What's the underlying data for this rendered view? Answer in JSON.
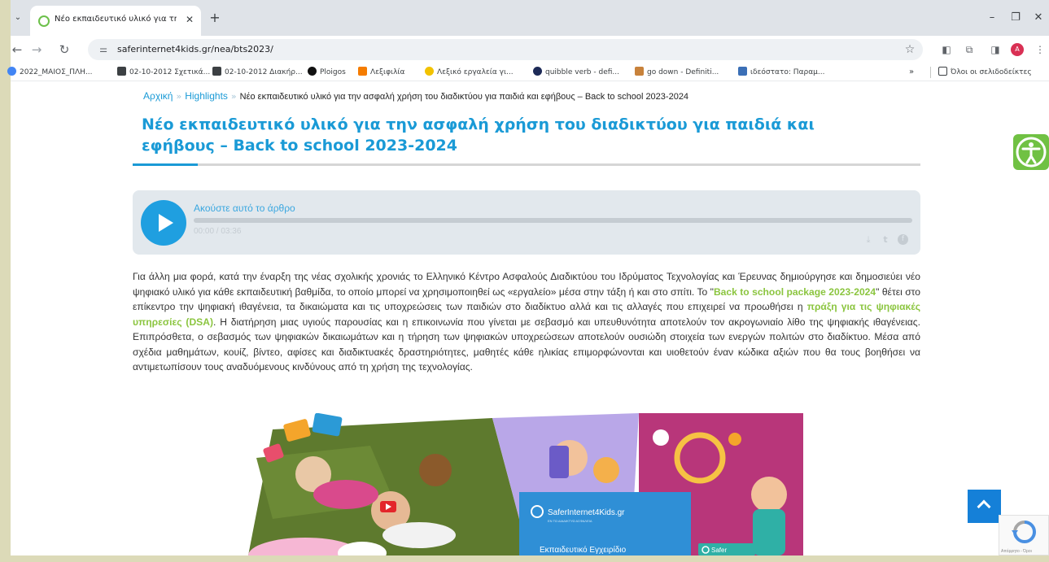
{
  "browser": {
    "tab": {
      "title": "Νέο εκπαιδευτικό υλικό για τη",
      "close": "✕"
    },
    "new_tab": "+",
    "window_controls": {
      "minimize": "–",
      "maximize": "❐",
      "close": "✕"
    },
    "url": "saferinternet4kids.gr/nea/bts2023/",
    "profile_initial": "A",
    "bookmarks": [
      {
        "label": "2022_ΜΑΙΟΣ_ΠΛΗ...",
        "icon": "drive-icon",
        "color": "#4285f4"
      },
      {
        "label": "02-10-2012 Σχετικά...",
        "icon": "page-icon",
        "color": "#3c4043"
      },
      {
        "label": "02-10-2012 Διακήρ...",
        "icon": "page-icon",
        "color": "#3c4043"
      },
      {
        "label": "Ploigos",
        "icon": "ploigos-icon",
        "color": "#111111"
      },
      {
        "label": "Λεξιφιλία",
        "icon": "lexifilia-icon",
        "color": "#f57c00"
      },
      {
        "label": "Λεξικό εργαλεία γι...",
        "icon": "dictionary-icon",
        "color": "#f2c200"
      },
      {
        "label": "quibble verb - defi...",
        "icon": "cambridge-icon",
        "color": "#1d2a57"
      },
      {
        "label": "go down - Definiti...",
        "icon": "oxford-icon",
        "color": "#c8823b"
      },
      {
        "label": "ιδεόστατο: Παραμ...",
        "icon": "book-icon",
        "color": "#3b6fb6"
      }
    ],
    "bookmarks_overflow": "»",
    "all_bookmarks": "Όλοι οι σελιδοδείκτες"
  },
  "breadcrumb": {
    "home": "Αρχική",
    "section": "Highlights",
    "current": "Νέο εκπαιδευτικό υλικό για την ασφαλή χρήση του διαδικτύου για παιδιά και εφήβους – Back to school 2023-2024",
    "separator": "»"
  },
  "article": {
    "title": "Νέο εκπαιδευτικό υλικό για την ασφαλή χρήση του διαδικτύου για παιδιά και εφήβους – Back to school 2023-2024",
    "player": {
      "label": "Ακούστε αυτό το άρθρο",
      "time": "00:00 / 03:36",
      "progress": 0
    },
    "body": [
      {
        "t": "Για άλλη μια φορά, κατά την έναρξη της νέας σχολικής χρονιάς το Ελληνικό Κέντρο Ασφαλούς Διαδικτύου του Ιδρύματος Τεχνολογίας και Έρευνας δημιούργησε και δημοσιεύει νέο ψηφιακό υλικό για κάθε εκπαιδευτική βαθμίδα, το οποίο μπορεί να χρησιμοποιηθεί ως «εργαλείο» μέσα στην τάξη ή και στο σπίτι. Το \""
      },
      {
        "t": "Back to school package 2023-2024",
        "link": true
      },
      {
        "t": "\" θέτει στο επίκεντρο την ψηφιακή ιθαγένεια, τα δικαιώματα και τις υποχρεώσεις των παιδιών στο διαδίκτυο αλλά και τις αλλαγές που επιχειρεί να προωθήσει η "
      },
      {
        "t": "πράξη για τις ψηφιακές υπηρεσίες (DSA)",
        "link": true
      },
      {
        "t": ".  Η διατήρηση μιας υγιούς παρουσίας και η επικοινωνία που γίνεται με σεβασμό και υπευθυνότητα αποτελούν τον ακρογωνιαίο λίθο της ψηφιακής ιθαγένειας. Επιπρόσθετα, ο σεβασμός των ψηφιακών δικαιωμάτων και η τήρηση των ψηφιακών υποχρεώσεων αποτελούν ουσιώδη στοιχεία των ενεργών πολιτών στο διαδίκτυο. Μέσα από σχέδια μαθημάτων, κουίζ, βίντεο, αφίσες και διαδικτυακές δραστηριότητες, μαθητές κάθε ηλικίας επιμορφώνονται και υιοθετούν έναν κώδικα αξιών που θα τους βοηθήσει να αντιμετωπίσουν τους αναδυόμενους κινδύνους από τη χρήση της τεχνολογίας."
      }
    ],
    "hero": {
      "brand": "SaferInternet4Kids.gr",
      "brand_tag": "ΕΝ ΤΩ ΔΙΑΔΙΚΤΥΩ ΑΣΦΑΛΕΙΑ",
      "handbook": "Εκπαιδευτικό Εγχειρίδιο",
      "brand_small": "Safer"
    }
  },
  "widgets": {
    "recaptcha": "Απόρρητο - Όροι"
  },
  "colors": {
    "accent": "#1a9ad6",
    "link_green": "#8bc53f",
    "scroll_top": "#1580d8",
    "a11y": "#70c143"
  }
}
